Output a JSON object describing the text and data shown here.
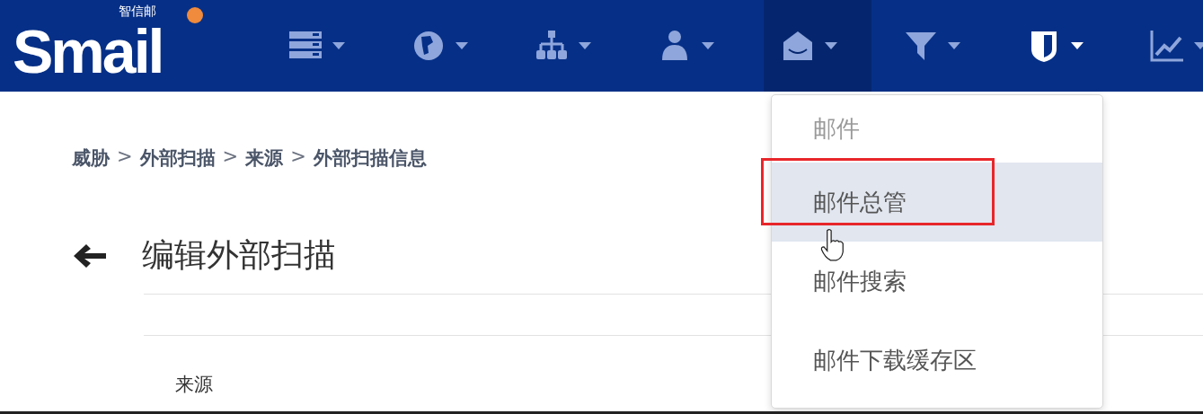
{
  "logo": {
    "text": "Smail",
    "subtitle": "智信邮"
  },
  "nav_items": [
    {
      "selected": false
    },
    {
      "selected": false
    },
    {
      "selected": false
    },
    {
      "selected": false
    },
    {
      "selected": true
    },
    {
      "selected": false
    },
    {
      "selected": false
    },
    {
      "selected": false
    }
  ],
  "breadcrumb": [
    {
      "kind": "crumb",
      "label": "威胁"
    },
    {
      "kind": "separator",
      "label": ">"
    },
    {
      "kind": "crumb",
      "label": "外部扫描"
    },
    {
      "kind": "separator",
      "label": ">"
    },
    {
      "kind": "crumb",
      "label": "来源"
    },
    {
      "kind": "separator",
      "label": ">"
    },
    {
      "kind": "crumb",
      "label": "外部扫描信息"
    }
  ],
  "page_title": "编辑外部扫描",
  "field_label": "来源",
  "dropdown": {
    "header": "邮件",
    "items": [
      {
        "label": "邮件总管",
        "selected": true,
        "marked": true
      },
      {
        "label": "邮件搜索",
        "selected": false,
        "marked": false
      },
      {
        "label": "邮件下载缓存区",
        "selected": false,
        "marked": false
      }
    ]
  }
}
